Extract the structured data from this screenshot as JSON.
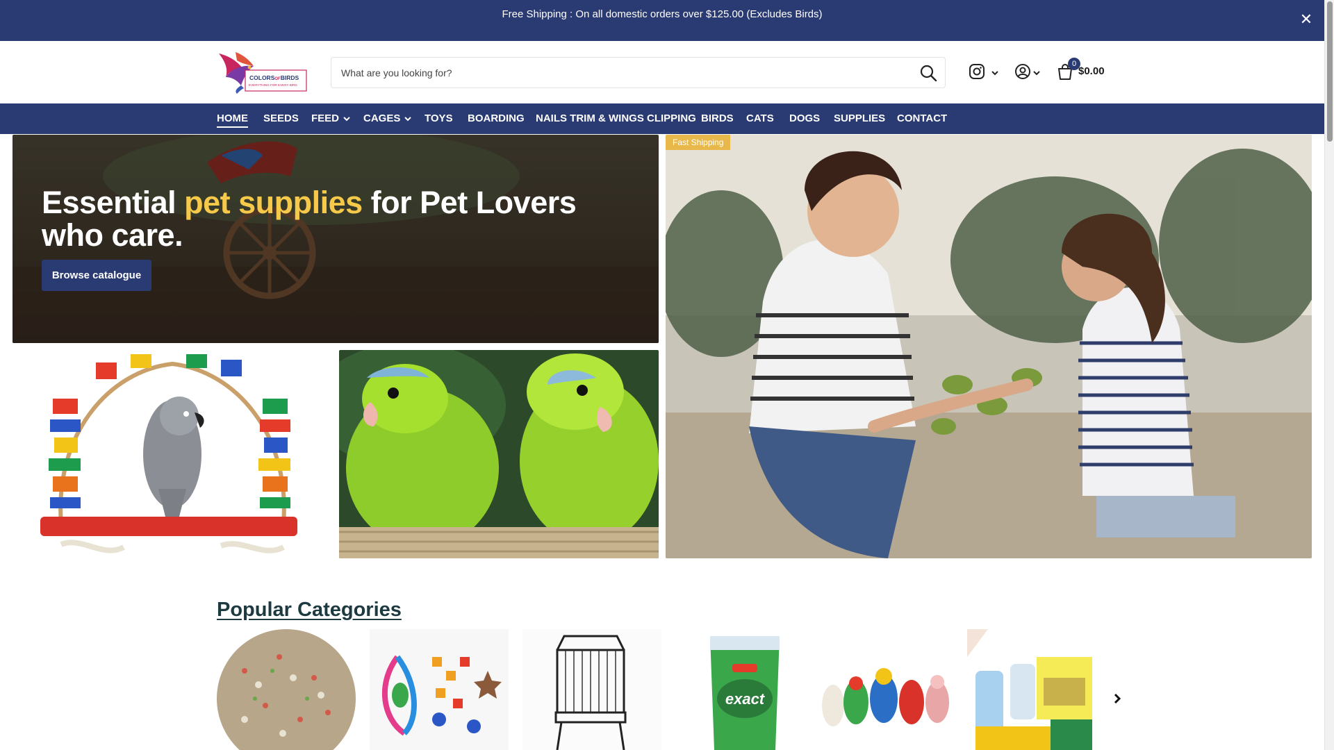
{
  "announcement": {
    "text": "Free Shipping : On all domestic orders over $125.00 (Excludes Birds)",
    "close": "✕"
  },
  "logo": {
    "line1_a": "COLORS",
    "line1_b": "OF",
    "line1_c": "BIRDS",
    "line2": "EVERYTHING FOR EVERY BIRD"
  },
  "search": {
    "placeholder": "What are you looking for?"
  },
  "cart": {
    "count": "0",
    "total": "$0.00"
  },
  "nav": {
    "items": [
      "HOME",
      "SEEDS",
      "FEED",
      "CAGES",
      "TOYS",
      "BOARDING",
      "NAILS TRIM & WINGS CLIPPING",
      "BIRDS",
      "CATS",
      "DOGS",
      "SUPPLIES",
      "CONTACT"
    ]
  },
  "hero": {
    "title_a": "Essential ",
    "title_highlight": "pet supplies",
    "title_b": " for Pet Lovers who care.",
    "button": "Browse catalogue"
  },
  "promo": {
    "badge": "Fast Shipping"
  },
  "categories": {
    "title": "Popular Categories"
  },
  "colors": {
    "brand": "#2a3a72",
    "highlight": "#f6c94a",
    "badge": "#e8b94a"
  }
}
